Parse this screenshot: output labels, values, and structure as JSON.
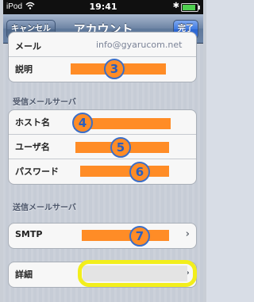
{
  "status_bar": {
    "carrier": "iPod",
    "time": "19:41",
    "bluetooth_icon": "bluetooth-icon",
    "battery_level": 0.9
  },
  "nav": {
    "title": "アカウント",
    "cancel_label": "キャンセル",
    "done_label": "完了"
  },
  "account_group": {
    "partial_label": "メール",
    "partial_value": "info@gyarucom.net",
    "description_label": "説明",
    "description_marker": "3"
  },
  "incoming": {
    "header": "受信メールサーバ",
    "host_label": "ホスト名",
    "host_marker": "4",
    "user_label": "ユーザ名",
    "user_marker": "5",
    "password_label": "パスワード",
    "password_marker": "6"
  },
  "outgoing": {
    "header": "送信メールサーバ",
    "smtp_label": "SMTP",
    "smtp_marker": "7"
  },
  "advanced": {
    "details_label": "詳細"
  },
  "colors": {
    "redaction": "#ff8c26",
    "highlight": "#f2ee1c",
    "marker_border": "#3a6ec8"
  }
}
